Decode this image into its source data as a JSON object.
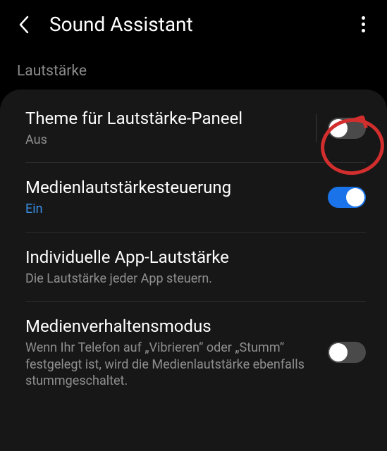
{
  "header": {
    "title": "Sound Assistant"
  },
  "section": {
    "label": "Lautstärke"
  },
  "rows": {
    "themePanel": {
      "title": "Theme für Lautstärke-Paneel",
      "sub": "Aus",
      "toggle": "off"
    },
    "mediaControl": {
      "title": "Medienlautstärkesteuerung",
      "sub": "Ein",
      "toggle": "on"
    },
    "appVolume": {
      "title": "Individuelle App-Lautstärke",
      "sub": "Die Lautstärke jeder App steuern."
    },
    "mediaBehavior": {
      "title": "Medienverhaltensmodus",
      "sub": "Wenn Ihr Telefon auf „Vibrieren“ oder „Stumm“ festgelegt ist, wird die Medienlautstärke ebenfalls stummgeschaltet.",
      "toggle": "off"
    }
  }
}
